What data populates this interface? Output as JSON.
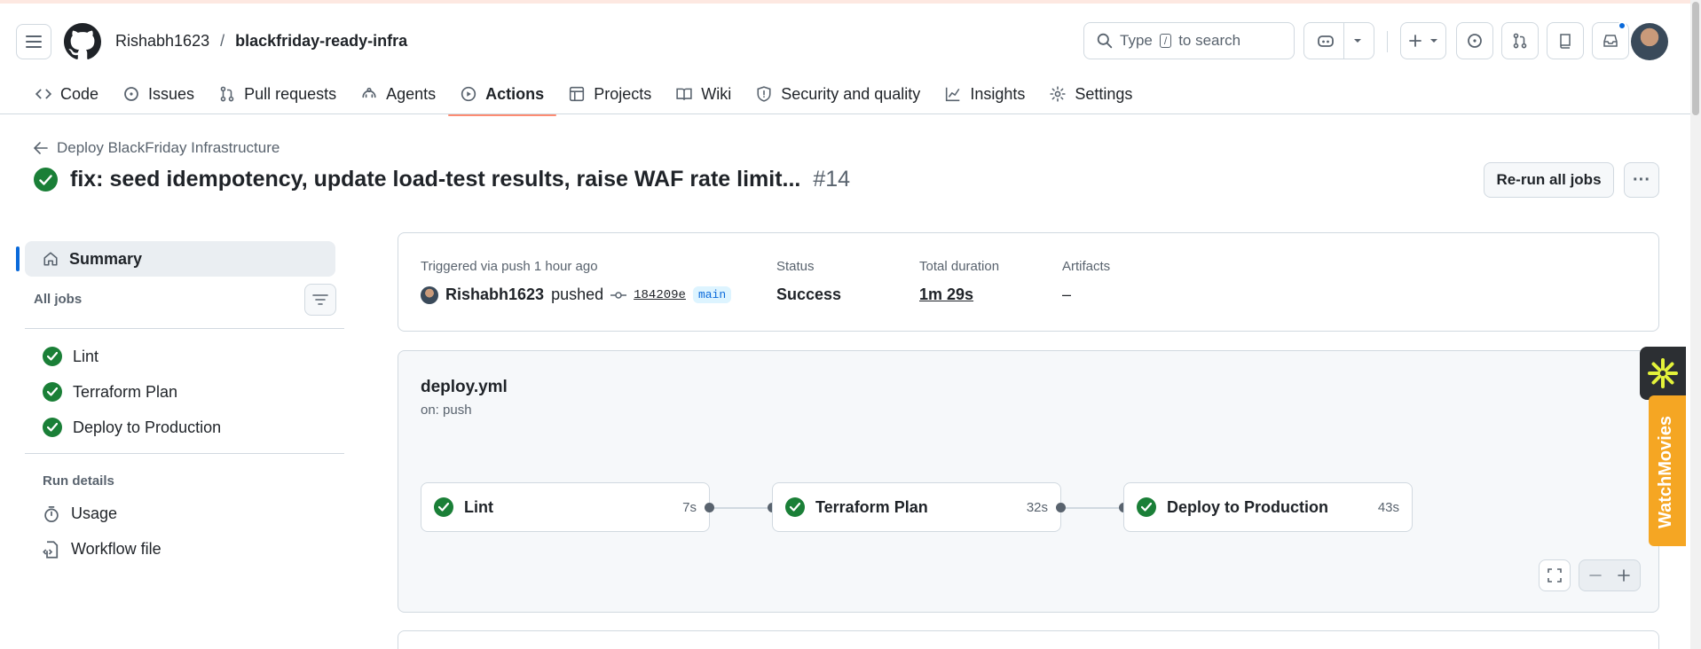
{
  "header": {
    "owner": "Rishabh1623",
    "separator": "/",
    "repo": "blackfriday-ready-infra",
    "search_prefix": "Type",
    "search_key": "/",
    "search_suffix": "to search"
  },
  "tabs": [
    {
      "label": "Code",
      "icon": "code-icon"
    },
    {
      "label": "Issues",
      "icon": "issue-icon"
    },
    {
      "label": "Pull requests",
      "icon": "pull-request-icon"
    },
    {
      "label": "Agents",
      "icon": "agent-icon"
    },
    {
      "label": "Actions",
      "icon": "play-icon",
      "active": true
    },
    {
      "label": "Projects",
      "icon": "table-icon"
    },
    {
      "label": "Wiki",
      "icon": "book-icon"
    },
    {
      "label": "Security and quality",
      "icon": "shield-icon"
    },
    {
      "label": "Insights",
      "icon": "graph-icon"
    },
    {
      "label": "Settings",
      "icon": "gear-icon"
    }
  ],
  "run": {
    "back_label": "Deploy BlackFriday Infrastructure",
    "title": "fix: seed idempotency, update load-test results, raise WAF rate limit...",
    "number": "#14",
    "rerun_label": "Re-run all jobs",
    "more_label": "···"
  },
  "sidebar": {
    "summary_label": "Summary",
    "all_jobs_label": "All jobs",
    "jobs": [
      "Lint",
      "Terraform Plan",
      "Deploy to Production"
    ],
    "run_details_label": "Run details",
    "usage_label": "Usage",
    "workflow_file_label": "Workflow file"
  },
  "summary_card": {
    "trigger_label": "Triggered via push 1 hour ago",
    "actor": "Rishabh1623",
    "action": "pushed",
    "sha": "184209e",
    "branch": "main",
    "status_label": "Status",
    "status_value": "Success",
    "duration_label": "Total duration",
    "duration_value": "1m 29s",
    "artifacts_label": "Artifacts",
    "artifacts_value": "–"
  },
  "workflow": {
    "name": "deploy.yml",
    "trigger": "on: push",
    "nodes": [
      {
        "label": "Lint",
        "duration": "7s"
      },
      {
        "label": "Terraform Plan",
        "duration": "32s"
      },
      {
        "label": "Deploy to Production",
        "duration": "43s"
      }
    ]
  },
  "extension": {
    "label": "WatchMovies"
  },
  "colors": {
    "success": "#1a7f37",
    "accent": "#0969da",
    "tab_underline": "#fd8c73"
  }
}
